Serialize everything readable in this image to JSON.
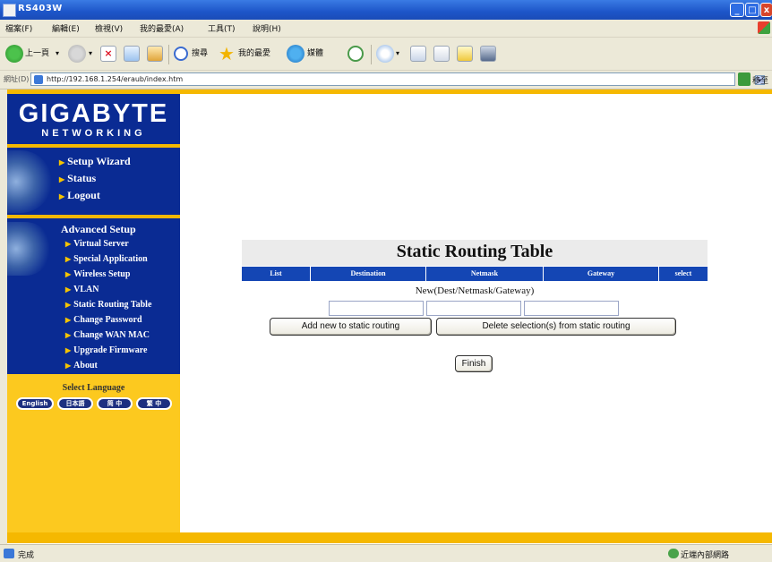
{
  "window": {
    "title": "RS403W",
    "min": "_",
    "max": "□",
    "close": "x"
  },
  "menubar": {
    "items": [
      "檔案(F)",
      "編輯(E)",
      "檢視(V)",
      "我的最愛(A)",
      "工具(T)",
      "說明(H)"
    ]
  },
  "toolbar": {
    "back_label": "上一頁",
    "search_label": "搜尋",
    "favorites_label": "我的最愛",
    "media_label": "媒體"
  },
  "address": {
    "label": "網址(D)",
    "url": "http://192.168.1.254/eraub/index.htm",
    "go_label": "移至"
  },
  "brand": {
    "logo_big": "GIGABYTE",
    "logo_small": "NETWORKING"
  },
  "sidebar": {
    "main_links": [
      "Setup Wizard",
      "Status",
      "Logout"
    ],
    "advanced_title": "Advanced Setup",
    "advanced_links": [
      "Virtual Server",
      "Special Application",
      "Wireless Setup",
      "VLAN",
      "Static Routing Table",
      "Change Password",
      "Change WAN MAC",
      "Upgrade Firmware",
      "About"
    ],
    "language_title": "Select Language",
    "languages": [
      "English",
      "日本語",
      "简 中",
      "繁 中"
    ]
  },
  "routing": {
    "title": "Static Routing Table",
    "columns": [
      "List",
      "Destination",
      "Netmask",
      "Gateway",
      "select"
    ],
    "new_label": "New(Dest/Netmask/Gateway)",
    "dest_value": "",
    "netmask_value": "",
    "gateway_value": "",
    "add_button": "Add new to static routing",
    "delete_button": "Delete selection(s) from static routing",
    "finish_button": "Finish"
  },
  "status": {
    "left": "完成",
    "zone": "近端內部網路"
  },
  "colors": {
    "nav_blue": "#0a2b93",
    "accent_yellow": "#f5b800",
    "header_blue": "#1446b4"
  }
}
